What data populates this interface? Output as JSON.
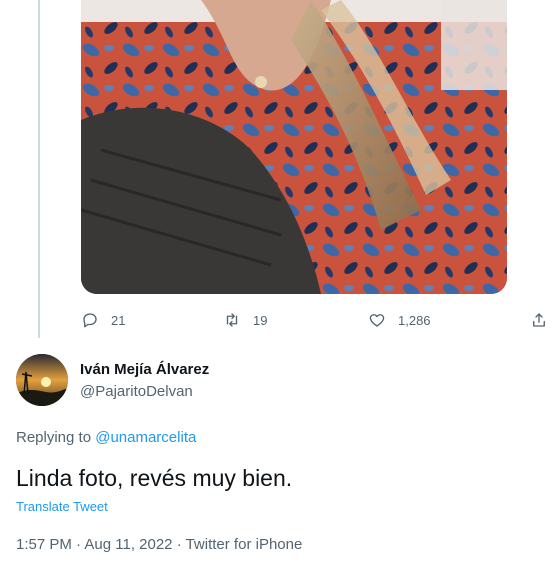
{
  "tweet_actions": {
    "reply_count": "21",
    "retweet_count": "19",
    "like_count": "1,286"
  },
  "reply": {
    "author_name": "Iván Mejía Álvarez",
    "author_handle": "@PajaritoDelvan",
    "replying_prefix": "Replying to ",
    "replying_to": "@unamarcelita",
    "text": "Linda foto, revés muy bien.",
    "translate_label": "Translate Tweet",
    "time": "1:57 PM",
    "separator": " · ",
    "date": "Aug 11, 2022",
    "source": "Twitter for iPhone"
  },
  "colors": {
    "accent": "#1d9bf0",
    "secondary_text": "#536471",
    "primary_text": "#0f1419",
    "thread_line": "#cfd9de"
  },
  "icons": [
    "reply-icon",
    "retweet-icon",
    "like-icon",
    "share-icon"
  ]
}
